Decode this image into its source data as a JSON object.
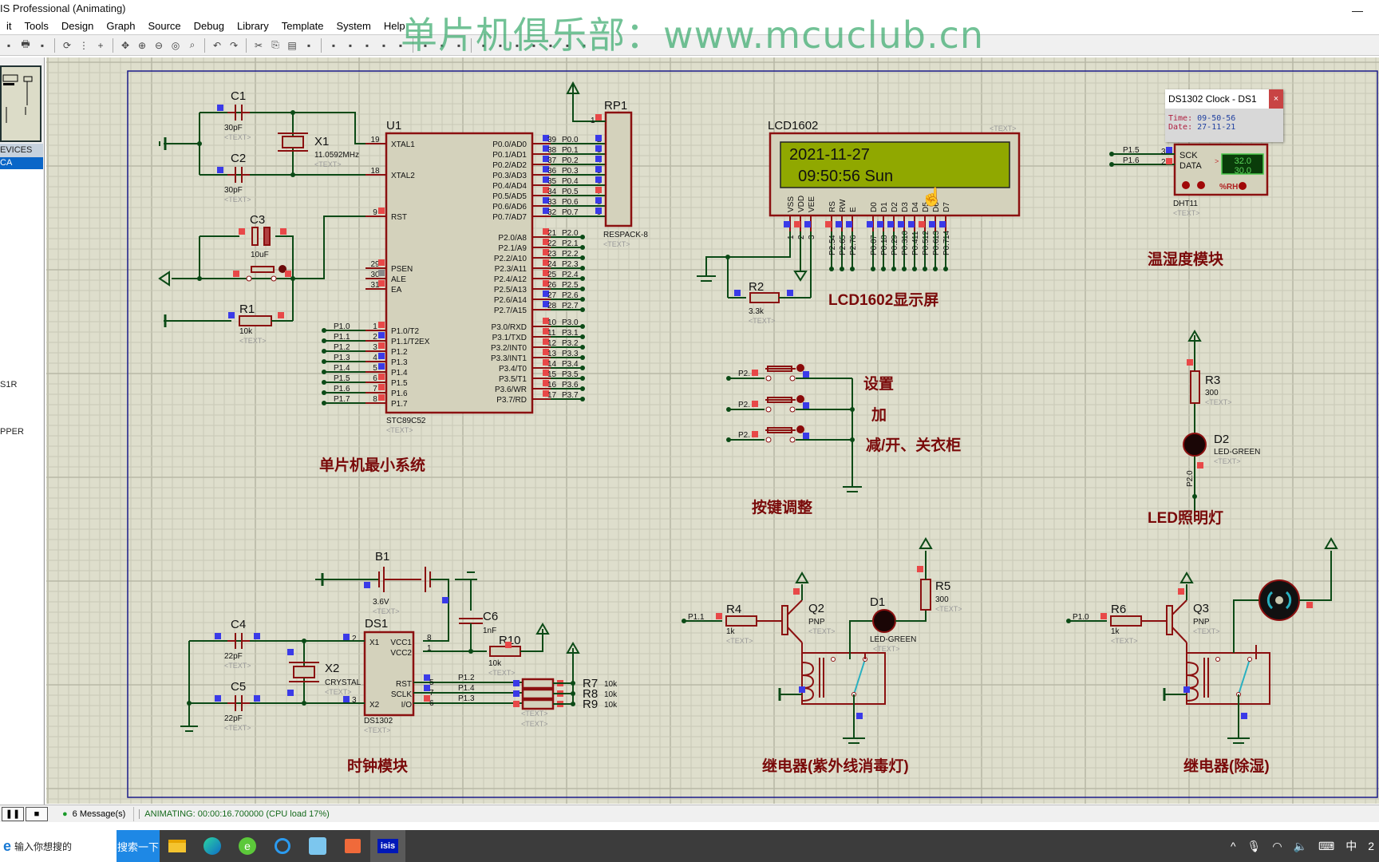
{
  "window": {
    "title": "IS Professional (Animating)",
    "minimize": "—"
  },
  "menu": [
    "it",
    "Tools",
    "Design",
    "Graph",
    "Source",
    "Debug",
    "Library",
    "Template",
    "System",
    "Help"
  ],
  "watermark": "单片机俱乐部：www.mcuclub.cn",
  "toolbar_icons": [
    "import-icon",
    "print-icon",
    "page-icon",
    "refresh-icon",
    "grid-icon",
    "origin-icon",
    "pan-icon",
    "zoom-in-icon",
    "zoom-out-icon",
    "zoom-all-icon",
    "zoom-area-icon",
    "undo-icon",
    "redo-icon",
    "cut-icon",
    "copy-icon",
    "paste-icon",
    "block-copy-icon",
    "block-move-icon",
    "block-rotate-icon",
    "block-delete-icon",
    "pick-icon",
    "make-device-icon",
    "package-icon",
    "decompose-icon",
    "wire-autorouter-icon",
    "search-tag-icon",
    "property-icon",
    "new-sheet-icon",
    "delete-sheet-icon",
    "bom-icon",
    "erc-icon",
    "ares-icon"
  ],
  "left_panel": {
    "devices_header": "EVICES",
    "selected": "CA",
    "items": [
      "S1R",
      "PPER"
    ]
  },
  "dialog": {
    "title": "DS1302 Clock - DS1",
    "close": "×",
    "time_label": "Time:",
    "time": "09-50-56",
    "date_label": "Date:",
    "date": "27-11-21"
  },
  "schematic": {
    "sections": {
      "mcu": "单片机最小系统",
      "lcd": "LCD1602显示屏",
      "dht": "温湿度模块",
      "keys": "按键调整",
      "led": "LED照明灯",
      "clock": "时钟模块",
      "relay1": "继电器(紫外线消毒灯)",
      "relay2": "继电器(除湿)"
    },
    "keys_labels": [
      "设置",
      "加",
      "减/开、关衣柜"
    ],
    "lcd": {
      "ref": "LCD1602",
      "line1": "2021-11-27",
      "line2": "  09:50:56 Sun",
      "pins": [
        "VSS",
        "VDD",
        "VEE",
        "RS",
        "RW",
        "E",
        "D0",
        "D1",
        "D2",
        "D3",
        "D4",
        "D5",
        "D6",
        "D7"
      ],
      "pin_nums": [
        "1",
        "2",
        "3",
        "4",
        "5",
        "6",
        "7",
        "8",
        "9",
        "10",
        "11",
        "12",
        "13",
        "14"
      ],
      "nets": [
        "P2.5",
        "P2.6",
        "P2.7",
        "P0.0",
        "P0.1",
        "P0.2",
        "P0.3",
        "P0.4",
        "P0.5",
        "P0.6",
        "P0.7"
      ]
    },
    "dht11": {
      "ref": "DHT11",
      "pin_sck": "SCK",
      "pin_data": "DATA",
      "temp": "32.0",
      "hum": "30.0",
      "unit": "%RH",
      "net1": "P1.5",
      "net2": "P1.6"
    },
    "u1": {
      "ref": "U1",
      "part": "STC89C52",
      "left_pins": [
        [
          "19",
          "XTAL1"
        ],
        [
          "18",
          "XTAL2"
        ],
        [
          "9",
          "RST"
        ],
        [
          "29",
          "PSEN"
        ],
        [
          "30",
          "ALE"
        ],
        [
          "31",
          "EA"
        ],
        [
          "1",
          "P1.0/T2"
        ],
        [
          "2",
          "P1.1/T2EX"
        ],
        [
          "3",
          "P1.2"
        ],
        [
          "4",
          "P1.3"
        ],
        [
          "5",
          "P1.4"
        ],
        [
          "6",
          "P1.5"
        ],
        [
          "7",
          "P1.6"
        ],
        [
          "8",
          "P1.7"
        ]
      ],
      "p0": [
        [
          "39",
          "P0.0/AD0"
        ],
        [
          "38",
          "P0.1/AD1"
        ],
        [
          "37",
          "P0.2/AD2"
        ],
        [
          "36",
          "P0.3/AD3"
        ],
        [
          "35",
          "P0.4/AD4"
        ],
        [
          "34",
          "P0.5/AD5"
        ],
        [
          "33",
          "P0.6/AD6"
        ],
        [
          "32",
          "P0.7/AD7"
        ]
      ],
      "p2": [
        [
          "21",
          "P2.0/A8"
        ],
        [
          "22",
          "P2.1/A9"
        ],
        [
          "23",
          "P2.2/A10"
        ],
        [
          "24",
          "P2.3/A11"
        ],
        [
          "25",
          "P2.4/A12"
        ],
        [
          "26",
          "P2.5/A13"
        ],
        [
          "27",
          "P2.6/A14"
        ],
        [
          "28",
          "P2.7/A15"
        ]
      ],
      "p3": [
        [
          "10",
          "P3.0/RXD"
        ],
        [
          "11",
          "P3.1/TXD"
        ],
        [
          "12",
          "P3.2/INT0"
        ],
        [
          "13",
          "P3.3/INT1"
        ],
        [
          "14",
          "P3.4/T0"
        ],
        [
          "15",
          "P3.5/T1"
        ],
        [
          "16",
          "P3.6/WR"
        ],
        [
          "17",
          "P3.7/RD"
        ]
      ]
    },
    "rp1": {
      "ref": "RP1",
      "part": "RESPACK-8"
    },
    "components": {
      "C1": "30pF",
      "C2": "30pF",
      "C3": "10uF",
      "X1": "11.0592MHz",
      "R1": "10k",
      "R2": "3.3k",
      "R3": "300",
      "D2": "LED-GREEN",
      "B1": "3.6V",
      "C4": "22pF",
      "C5": "22pF",
      "C6": "1nF",
      "X2": "CRYSTAL",
      "R10": "10k",
      "DS1": "DS1302",
      "R7": "10k",
      "R8": "10k",
      "R9": "10k",
      "R4": "1k",
      "Q2": "PNP",
      "D1": "LED-GREEN",
      "R5": "300",
      "R6": "1k",
      "Q3": "PNP"
    },
    "ds1302_pins": [
      [
        "2",
        "X1"
      ],
      [
        "3",
        "X2"
      ],
      [
        "8",
        "VCC1"
      ],
      [
        "1",
        "VCC2"
      ],
      [
        "5",
        "RST"
      ],
      [
        "7",
        "SCLK"
      ],
      [
        "6",
        "I/O"
      ]
    ],
    "placeholder": "<TEXT>"
  },
  "status": {
    "messages": "6 Message(s)",
    "animating": "ANIMATING: 00:00:16.700000 (CPU load 17%)"
  },
  "taskbar": {
    "search_placeholder": "输入你想搜的",
    "search_button": "搜索一下",
    "tray_ime": "中",
    "tray_time": "2"
  }
}
